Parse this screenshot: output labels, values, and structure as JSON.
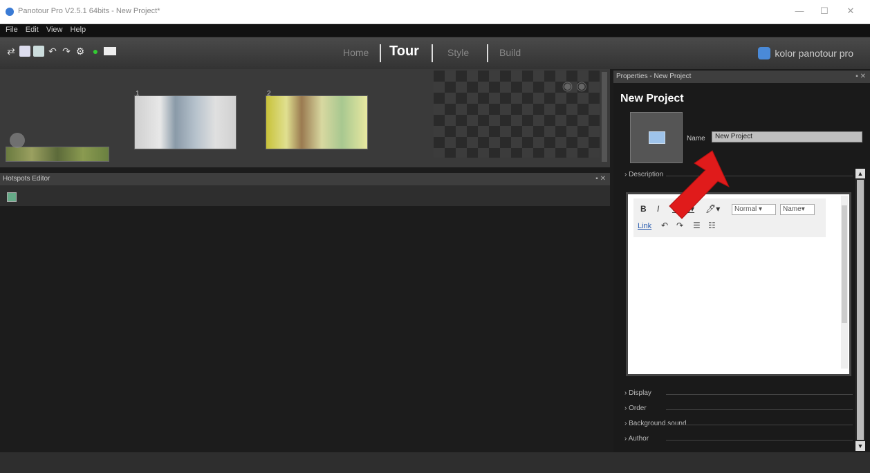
{
  "window": {
    "title": "Panotour Pro V2.5.1 64bits - New Project*",
    "controls": [
      "—",
      "☐",
      "✕"
    ]
  },
  "menu": [
    "File",
    "Edit",
    "View",
    "Help"
  ],
  "toolbar": {
    "icons": [
      "add-panorama-icon",
      "new-icon",
      "save-icon",
      "undo-icon",
      "redo-icon",
      "settings-icon",
      "play-icon",
      "folder-icon"
    ],
    "tabs": [
      "Home",
      "Tour",
      "Style",
      "Build"
    ],
    "active_tab": "Tour",
    "brand": "kolor panotour pro"
  },
  "thumbnails": [
    {
      "number": "1"
    },
    {
      "number": "2"
    }
  ],
  "hotspots_panel": {
    "title": "Hotspots Editor"
  },
  "properties": {
    "header": "Properties - New Project",
    "project_title": "New Project",
    "name_label": "Name",
    "name_value": "New Project",
    "sections": [
      "Description",
      "Display",
      "Order",
      "Background sound",
      "Author"
    ],
    "editor": {
      "format_value": "Normal",
      "font_value": "Name",
      "link_label": "Link"
    }
  },
  "colors": {
    "accent_arrow": "#e01b1b",
    "background": "#1c1c1c"
  }
}
